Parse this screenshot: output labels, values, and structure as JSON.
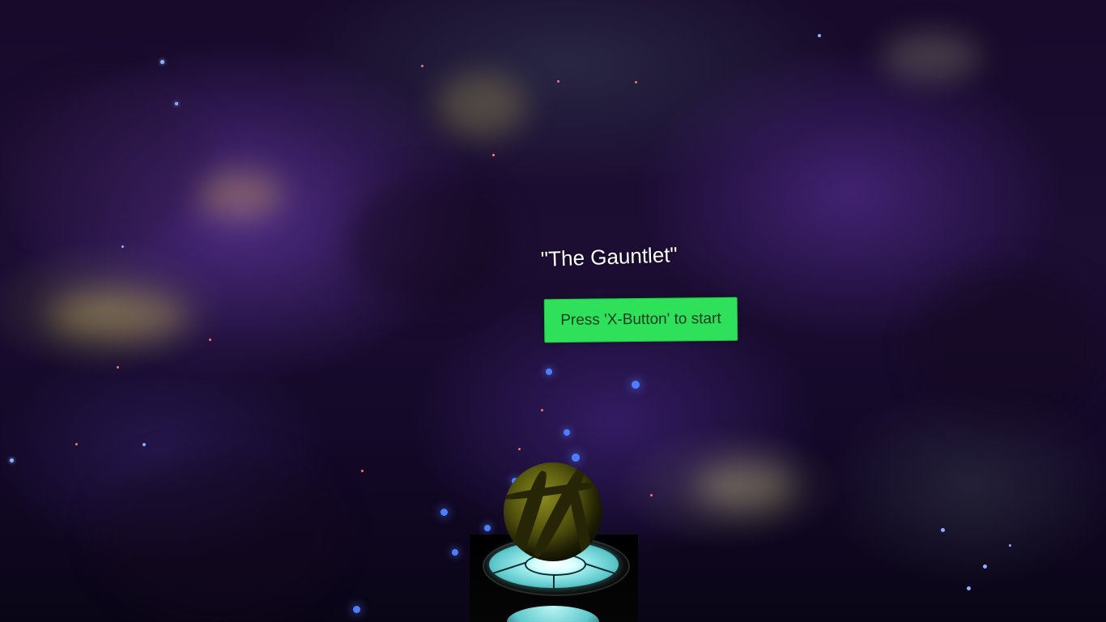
{
  "game": {
    "title": "\"The Gauntlet\"",
    "start_prompt": "Press 'X-Button' to start"
  },
  "colors": {
    "start_button": "#2ee05a",
    "start_button_text": "#1d3a22",
    "title_text": "#ffffff",
    "pad_glow": "#7be0e0",
    "orb": "#6a6a18"
  },
  "icons": {
    "orb": "striped-sphere",
    "pedestal": "glowing-launch-pad"
  }
}
